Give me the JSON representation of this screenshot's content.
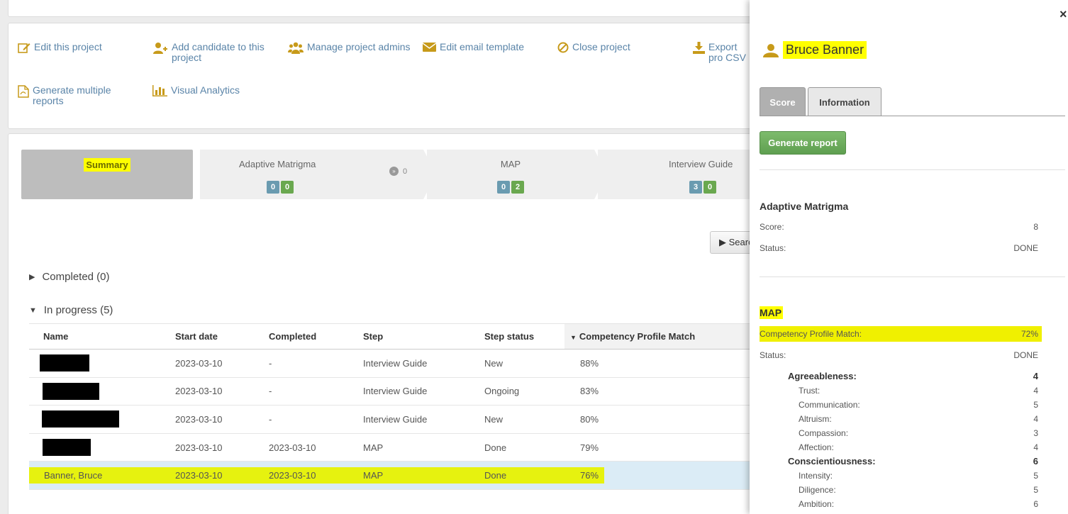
{
  "actions": [
    {
      "label": "Edit this project",
      "icon": "edit-icon"
    },
    {
      "label": "Add candidate to this project",
      "icon": "add-user-icon"
    },
    {
      "label": "Manage project admins",
      "icon": "users-icon"
    },
    {
      "label": "Edit email template",
      "icon": "envelope-icon"
    },
    {
      "label": "Close project",
      "icon": "ban-icon"
    },
    {
      "label": "Export pro CSV",
      "icon": "download-icon"
    },
    {
      "label": "Generate multiple reports",
      "icon": "pdf-icon"
    },
    {
      "label": "Visual Analytics",
      "icon": "bar-chart-icon"
    }
  ],
  "steps": {
    "summary": "Summary",
    "adaptive": {
      "title": "Adaptive Matrigma",
      "badge_a": "0",
      "badge_b": "0"
    },
    "skip_count": "0",
    "map": {
      "title": "MAP",
      "badge_a": "0",
      "badge_b": "2"
    },
    "interview": {
      "title": "Interview Guide",
      "badge_a": "3",
      "badge_b": "0"
    }
  },
  "search_label": "▶ Search",
  "groups": {
    "completed": "Completed (0)",
    "in_progress": "In progress (5)"
  },
  "table": {
    "headers": [
      "Name",
      "Start date",
      "Completed",
      "Step",
      "Step status",
      "Competency Profile Match"
    ],
    "rows": [
      {
        "name": "",
        "start": "2023-03-10",
        "completed": "-",
        "step": "Interview Guide",
        "status": "New",
        "match": "88%"
      },
      {
        "name": "",
        "start": "2023-03-10",
        "completed": "-",
        "step": "Interview Guide",
        "status": "Ongoing",
        "match": "83%"
      },
      {
        "name": "",
        "start": "2023-03-10",
        "completed": "-",
        "step": "Interview Guide",
        "status": "New",
        "match": "80%"
      },
      {
        "name": "",
        "start": "2023-03-10",
        "completed": "2023-03-10",
        "step": "MAP",
        "status": "Done",
        "match": "79%"
      },
      {
        "name": "Banner, Bruce",
        "start": "2023-03-10",
        "completed": "2023-03-10",
        "step": "MAP",
        "status": "Done",
        "match": "76%"
      }
    ]
  },
  "side": {
    "close": "×",
    "candidate_name": "Bruce Banner",
    "tabs": {
      "score": "Score",
      "information": "Information"
    },
    "generate_report": "Generate report",
    "adaptive": {
      "title": "Adaptive Matrigma",
      "score_label": "Score:",
      "score_value": "8",
      "status_label": "Status:",
      "status_value": "DONE"
    },
    "map": {
      "title": "MAP",
      "cpm_label": "Competency Profile Match:",
      "cpm_value": "72%",
      "status_label": "Status:",
      "status_value": "DONE",
      "traits": [
        {
          "name": "Agreeableness:",
          "value": "4",
          "subs": [
            {
              "name": "Trust:",
              "value": "4"
            },
            {
              "name": "Communication:",
              "value": "5"
            },
            {
              "name": "Altruism:",
              "value": "4"
            },
            {
              "name": "Compassion:",
              "value": "3"
            },
            {
              "name": "Affection:",
              "value": "4"
            }
          ]
        },
        {
          "name": "Conscientiousness:",
          "value": "6",
          "subs": [
            {
              "name": "Intensity:",
              "value": "5"
            },
            {
              "name": "Diligence:",
              "value": "5"
            },
            {
              "name": "Ambition:",
              "value": "6"
            }
          ]
        }
      ]
    }
  },
  "colors": {
    "accent": "#c79a1a",
    "link": "#5a84a8",
    "highlight": "#ffff00",
    "green": "#6aa84f"
  }
}
